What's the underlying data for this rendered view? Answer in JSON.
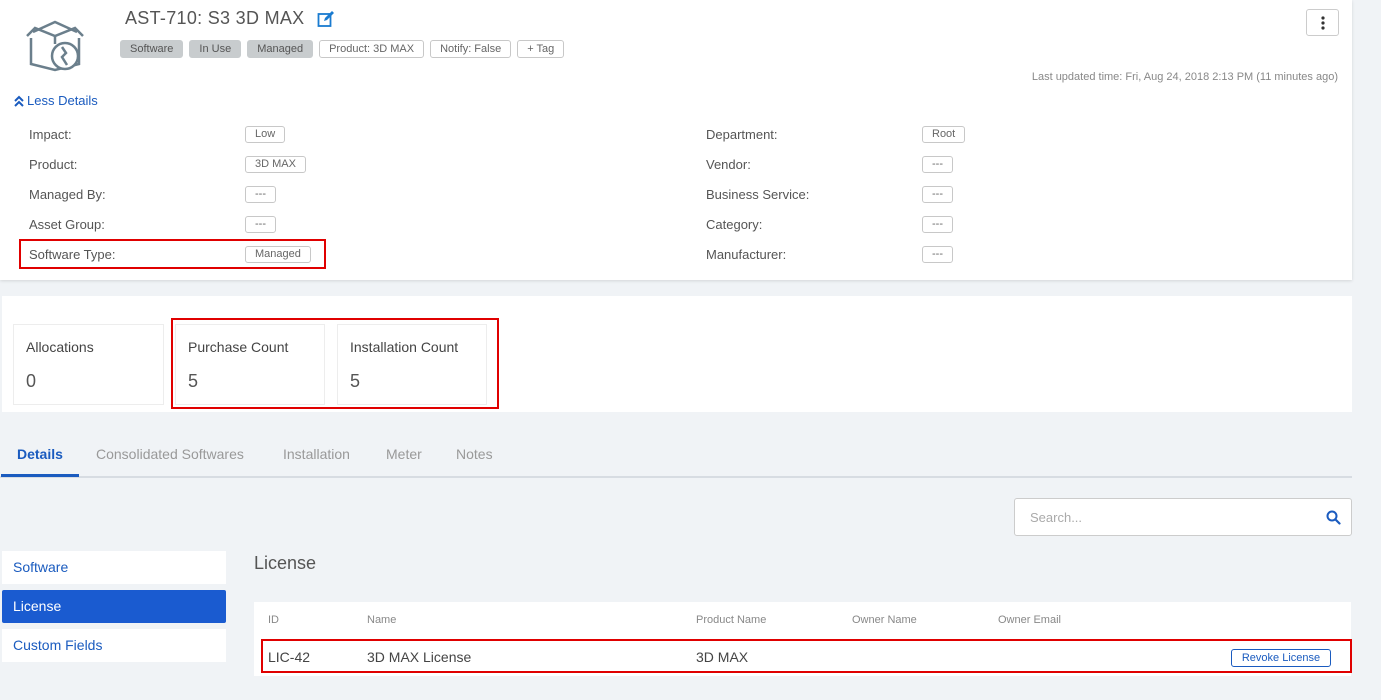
{
  "asset": {
    "title": "AST-710: S3 3D MAX",
    "tags": [
      "Software",
      "In Use",
      "Managed",
      "Product: 3D MAX",
      "Notify: False"
    ],
    "add_tag_label": "+ Tag",
    "last_updated": "Last updated time: Fri, Aug 24, 2018 2:13 PM (11 minutes ago)",
    "less_details_label": "Less Details"
  },
  "details": {
    "left": [
      {
        "label": "Impact:",
        "value": "Low"
      },
      {
        "label": "Product:",
        "value": "3D MAX"
      },
      {
        "label": "Managed By:",
        "value": "---"
      },
      {
        "label": "Asset Group:",
        "value": "---"
      },
      {
        "label": "Software Type:",
        "value": "Managed"
      }
    ],
    "right": [
      {
        "label": "Department:",
        "value": "Root"
      },
      {
        "label": "Vendor:",
        "value": "---"
      },
      {
        "label": "Business Service:",
        "value": "---"
      },
      {
        "label": "Category:",
        "value": "---"
      },
      {
        "label": "Manufacturer:",
        "value": "---"
      }
    ]
  },
  "stats": [
    {
      "label": "Allocations",
      "value": "0"
    },
    {
      "label": "Purchase Count",
      "value": "5"
    },
    {
      "label": "Installation Count",
      "value": "5"
    }
  ],
  "tabs": [
    "Details",
    "Consolidated Softwares",
    "Installation",
    "Meter",
    "Notes"
  ],
  "search": {
    "placeholder": "Search..."
  },
  "sidebar": {
    "items": [
      "Software",
      "License",
      "Custom Fields"
    ]
  },
  "license": {
    "section_title": "License",
    "columns": [
      "ID",
      "Name",
      "Product Name",
      "Owner Name",
      "Owner Email"
    ],
    "rows": [
      {
        "id": "LIC-42",
        "name": "3D MAX License",
        "product": "3D MAX",
        "owner_name": "",
        "owner_email": ""
      }
    ],
    "revoke_label": "Revoke License"
  },
  "colors": {
    "accent": "#1a5bbf",
    "highlight": "#e00000",
    "tag_filled": "#c8ccce"
  }
}
